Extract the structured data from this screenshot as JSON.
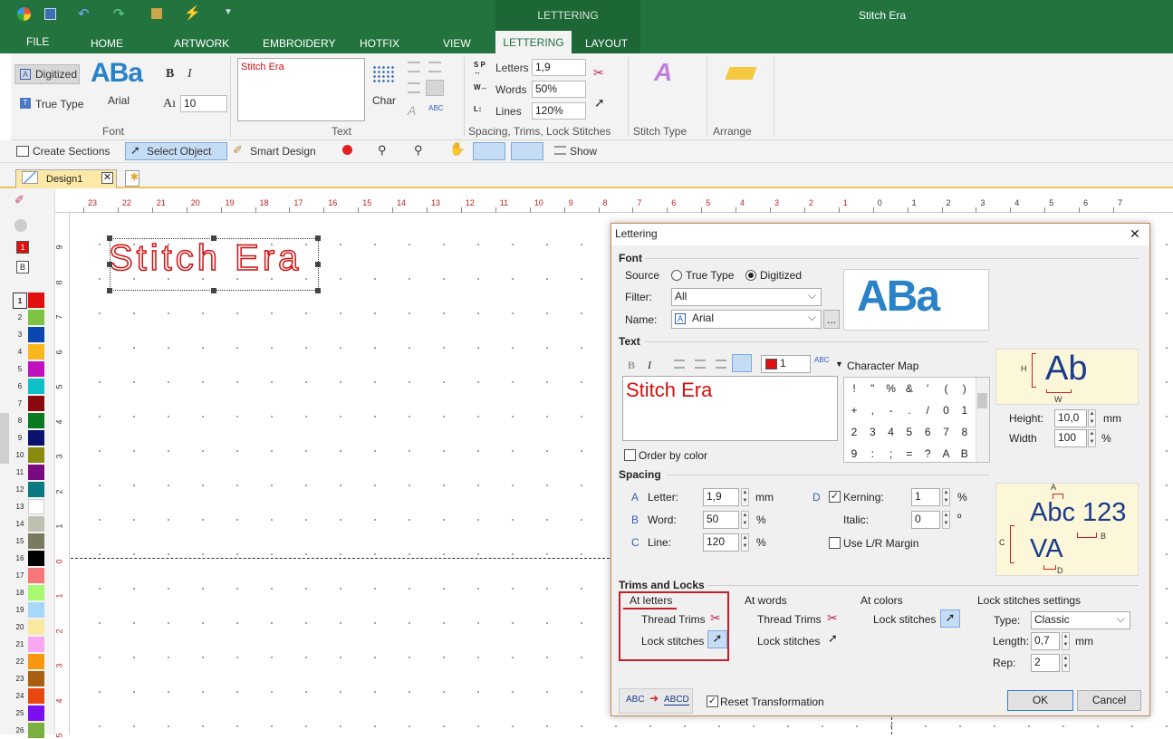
{
  "app": {
    "title": "Stitch Era",
    "context_tab_group": "LETTERING"
  },
  "ribbon_tabs": [
    "FILE",
    "HOME",
    "ARTWORK",
    "EMBROIDERY",
    "HOTFIX",
    "VIEW",
    "LETTERING",
    "LAYOUT"
  ],
  "font_group": {
    "digitized": "Digitized",
    "true_type": "True Type",
    "font_name": "Arial",
    "preview": "ABa",
    "bold": "B",
    "italic": "I",
    "size_icon": "Aı",
    "size": "10",
    "label": "Font"
  },
  "text_group": {
    "text": "Stitch Era",
    "char_label": "Char",
    "label": "Text"
  },
  "spacing_group": {
    "letters_label": "Letters",
    "letters": "1,9",
    "words_label": "Words",
    "words": "50%",
    "lines_label": "Lines",
    "lines": "120%",
    "label": "Spacing, Trims, Lock Stitches"
  },
  "stitch_type_group": {
    "label": "Stitch Type"
  },
  "arrange_group": {
    "label": "Arrange"
  },
  "toolbar": {
    "create_sections": "Create Sections",
    "select_object": "Select Object",
    "smart_design": "Smart Design",
    "show": "Show"
  },
  "document": {
    "tab": "Design1",
    "ruler_unit": "cm",
    "hruler_labels": [
      "23",
      "22",
      "21",
      "20",
      "19",
      "18",
      "17",
      "16",
      "15",
      "14",
      "13",
      "12",
      "11",
      "10",
      "9",
      "8",
      "7",
      "6",
      "5",
      "4",
      "3",
      "2",
      "1",
      "0",
      "1",
      "2",
      "3",
      "4",
      "5",
      "6",
      "7"
    ],
    "vruler_labels": [
      "9",
      "8",
      "7",
      "6",
      "5",
      "4",
      "3",
      "2",
      "1",
      "0",
      "1",
      "2",
      "3",
      "4",
      "5"
    ],
    "canvas_text": "Stitch Era"
  },
  "left_tools": {
    "current_color": "1",
    "border_mode": "B"
  },
  "palette": [
    {
      "n": "1",
      "c": "#e01010"
    },
    {
      "n": "2",
      "c": "#7dc242"
    },
    {
      "n": "3",
      "c": "#0a47b0"
    },
    {
      "n": "4",
      "c": "#f8b71c"
    },
    {
      "n": "5",
      "c": "#c010c0"
    },
    {
      "n": "6",
      "c": "#10c0c8"
    },
    {
      "n": "7",
      "c": "#8a0a10"
    },
    {
      "n": "8",
      "c": "#0a7a20"
    },
    {
      "n": "9",
      "c": "#0a1270"
    },
    {
      "n": "10",
      "c": "#8a8a10"
    },
    {
      "n": "11",
      "c": "#7a0a80"
    },
    {
      "n": "12",
      "c": "#0a7a80"
    },
    {
      "n": "13",
      "c": "#ffffff"
    },
    {
      "n": "14",
      "c": "#c0c0b0"
    },
    {
      "n": "15",
      "c": "#7a7a60"
    },
    {
      "n": "16",
      "c": "#000000"
    },
    {
      "n": "17",
      "c": "#f87878"
    },
    {
      "n": "18",
      "c": "#a8f870"
    },
    {
      "n": "19",
      "c": "#a8d8f8"
    },
    {
      "n": "20",
      "c": "#f8e8a0"
    },
    {
      "n": "21",
      "c": "#f8a8f0"
    },
    {
      "n": "22",
      "c": "#f89810"
    },
    {
      "n": "23",
      "c": "#a86010"
    },
    {
      "n": "24",
      "c": "#e84810"
    },
    {
      "n": "25",
      "c": "#7a10f0"
    },
    {
      "n": "26",
      "c": "#7ab040"
    }
  ],
  "dialog": {
    "title": "Lettering",
    "font": {
      "heading": "Font",
      "source_label": "Source",
      "opt_truetype": "True Type",
      "opt_digitized": "Digitized",
      "filter_label": "Filter:",
      "filter": "All",
      "name_label": "Name:",
      "name": "Arial",
      "browse": "...",
      "preview": "ABa"
    },
    "text": {
      "heading": "Text",
      "bold": "B",
      "italic": "I",
      "color_num": "1",
      "char_map": "Character Map",
      "value": "Stitch Era",
      "order_by_color": "Order by color",
      "chars": [
        "!",
        "\"",
        "%",
        "&",
        "'",
        "(",
        ")",
        "+",
        ",",
        "-",
        ".",
        "/",
        "0",
        "1",
        "2",
        "3",
        "4",
        "5",
        "6",
        "7",
        "8",
        "9",
        ":",
        ";",
        "=",
        "?",
        "A",
        "B"
      ],
      "preview": "Ab",
      "height_label": "Height:",
      "height": "10,0",
      "height_unit": "mm",
      "width_label": "Width",
      "width": "100",
      "width_unit": "%",
      "h": "H",
      "w": "W"
    },
    "spacing": {
      "heading": "Spacing",
      "a": "A",
      "b": "B",
      "c": "C",
      "d": "D",
      "letter_label": "Letter:",
      "letter": "1,9",
      "letter_unit": "mm",
      "word_label": "Word:",
      "word": "50",
      "word_unit": "%",
      "line_label": "Line:",
      "line": "120",
      "line_unit": "%",
      "kerning_label": "Kerning:",
      "kerning": "1",
      "kerning_unit": "%",
      "italic_label": "Italic:",
      "italic": "0",
      "italic_unit": "º",
      "lr_margin": "Use L/R Margin",
      "preview1": "Abc 123",
      "preview2": "VA"
    },
    "trims": {
      "heading": "Trims and Locks",
      "at_letters": "At letters",
      "at_words": "At words",
      "at_colors": "At colors",
      "thread_trims": "Thread Trims",
      "lock_stitches": "Lock stitches",
      "lock_settings": "Lock stitches settings",
      "type_label": "Type:",
      "type": "Classic",
      "length_label": "Length:",
      "length": "0,7",
      "length_unit": "mm",
      "rep_label": "Rep:",
      "rep": "2"
    },
    "footer": {
      "abc1": "ABC",
      "abc2": "ABCD",
      "reset": "Reset Transformation",
      "ok": "OK",
      "cancel": "Cancel"
    }
  }
}
